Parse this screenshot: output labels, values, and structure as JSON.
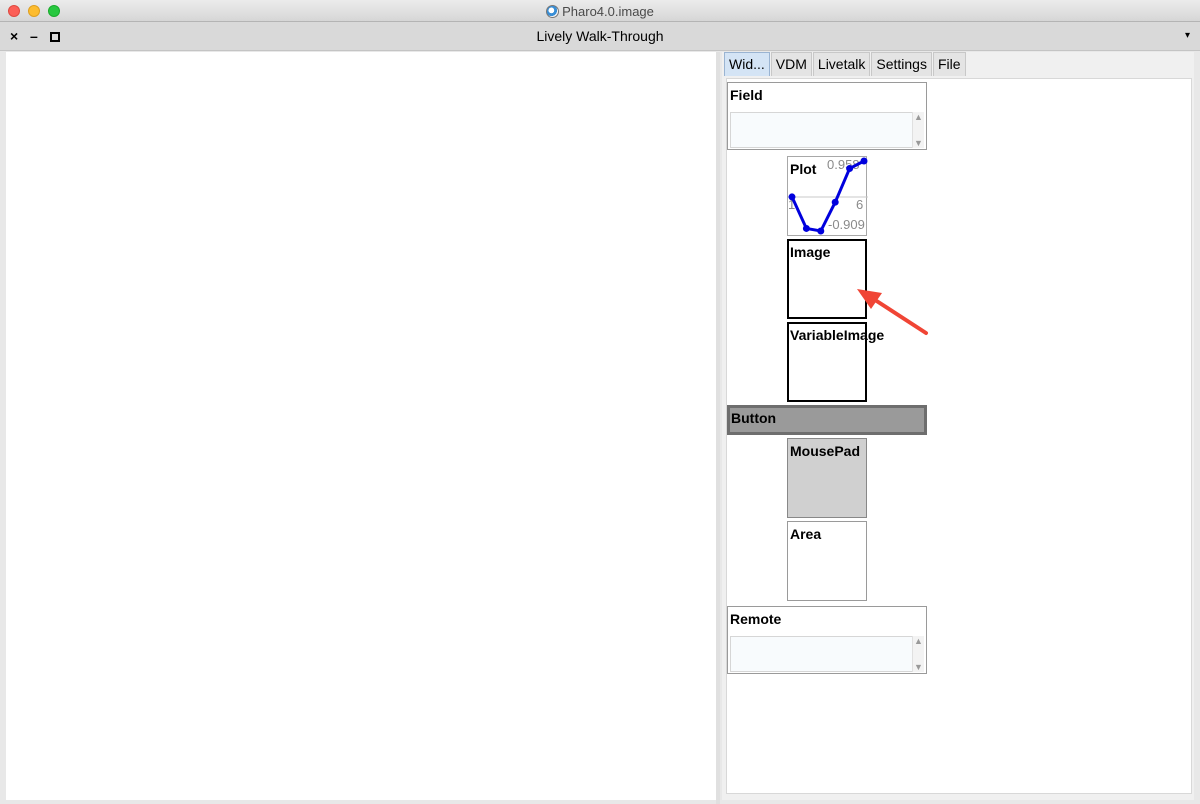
{
  "os_window": {
    "title": "Pharo4.0.image"
  },
  "pharo_window": {
    "title": "Lively Walk-Through",
    "close_glyph": "×",
    "minimize_glyph": "–",
    "menu_glyph": "▾"
  },
  "tabs": [
    {
      "label": "Wid...",
      "active": true
    },
    {
      "label": "VDM",
      "active": false
    },
    {
      "label": "Livetalk",
      "active": false
    },
    {
      "label": "Settings",
      "active": false
    },
    {
      "label": "File",
      "active": false
    }
  ],
  "widgets": {
    "field": {
      "label": "Field",
      "value": ""
    },
    "plot": {
      "label": "Plot",
      "y_max_label": "0.958",
      "y_min_label": "-0.909",
      "x_min_label": "1",
      "x_max_label": "6"
    },
    "image": {
      "label": "Image"
    },
    "variable_image": {
      "label": "VariableImage"
    },
    "button": {
      "label": "Button"
    },
    "mousepad": {
      "label": "MousePad"
    },
    "area": {
      "label": "Area"
    },
    "remote": {
      "label": "Remote",
      "value": ""
    }
  },
  "chart_data": {
    "type": "line",
    "x": [
      1,
      2,
      3,
      4,
      5,
      6
    ],
    "values": [
      0.0,
      -0.841,
      -0.909,
      -0.141,
      0.757,
      0.958
    ],
    "ylim": [
      -0.909,
      0.958
    ],
    "xlim": [
      1,
      6
    ],
    "color": "#0000dd"
  },
  "colors": {
    "annotation_arrow": "#f04535"
  }
}
